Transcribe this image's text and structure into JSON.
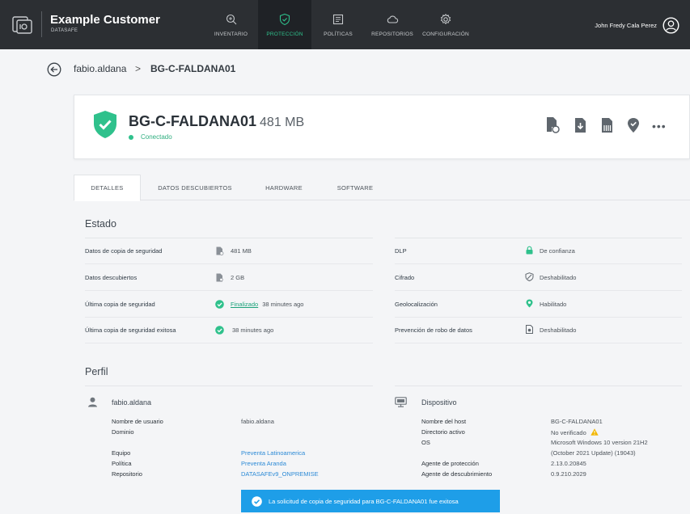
{
  "header": {
    "brand_name": "Example Customer",
    "brand_sub": "DATASAFE",
    "nav": [
      {
        "label": "INVENTARIO",
        "icon": "search-icon",
        "active": false
      },
      {
        "label": "PROTECCIÓN",
        "icon": "shield-icon",
        "active": true
      },
      {
        "label": "POLÍTICAS",
        "icon": "document-icon",
        "active": false
      },
      {
        "label": "REPOSITORIOS",
        "icon": "cloud-icon",
        "active": false
      },
      {
        "label": "CONFIGURACIÓN",
        "icon": "gear-icon",
        "active": false
      }
    ],
    "user_name": "John Fredy Cala Perez"
  },
  "breadcrumb": {
    "parent": "fabio.aldana",
    "separator": ">",
    "current": "BG-C-FALDANA01"
  },
  "device": {
    "name": "BG-C-FALDANA01",
    "size": "481 MB",
    "status": "Conectado",
    "more_label": "•••"
  },
  "tabs": [
    "DETALLES",
    "DATOS DESCUBIERTOS",
    "HARDWARE",
    "SOFTWARE"
  ],
  "estado": {
    "title": "Estado",
    "left": [
      {
        "label": "Datos de copia de seguridad",
        "icon": "backup-file-icon",
        "value": "481 MB",
        "link": ""
      },
      {
        "label": "Datos descubiertos",
        "icon": "discovered-file-icon",
        "value": "2 GB",
        "link": ""
      },
      {
        "label": "Última copia de seguridad",
        "icon": "check-circle-icon",
        "link": "Finalizado",
        "value": "38 minutes ago"
      },
      {
        "label": "Última copia de seguridad exitosa",
        "icon": "check-circle-icon",
        "value": "38 minutes ago",
        "link": ""
      }
    ],
    "right": [
      {
        "label": "DLP",
        "icon": "lock-icon",
        "value": "De confianza"
      },
      {
        "label": "Cifrado",
        "icon": "shield-off-icon",
        "value": "Deshabilitado"
      },
      {
        "label": "Geolocalización",
        "icon": "location-pin-icon",
        "value": "Habilitado"
      },
      {
        "label": "Prevención de robo de datos",
        "icon": "theft-prevention-icon",
        "value": "Deshabilitado"
      }
    ]
  },
  "perfil": {
    "title": "Perfil",
    "user": {
      "heading": "fabio.aldana",
      "fields": [
        {
          "label": "Nombre de usuario",
          "value": "fabio.aldana",
          "link": false
        },
        {
          "label": "Dominio",
          "value": "",
          "link": false
        },
        {
          "label": "Equipo",
          "value": "Preventa Latinoamerica",
          "link": true
        },
        {
          "label": "Política",
          "value": "Preventa Aranda",
          "link": true
        },
        {
          "label": "Repositorio",
          "value": "DATASAFEv9_ONPREMISE",
          "link": true
        }
      ]
    },
    "device": {
      "heading": "Dispositivo",
      "fields": [
        {
          "label": "Nombre del host",
          "value": "BG-C-FALDANA01"
        },
        {
          "label": "Directorio activo",
          "value": "No verificado"
        },
        {
          "label": "OS",
          "value": "Microsoft Windows 10 version 21H2",
          "value2": "(October 2021 Update) (19043)"
        },
        {
          "label": "Agente de protección",
          "value": "2.13.0.20845"
        },
        {
          "label": "Agente de descubrimiento",
          "value": "0.9.210.2029"
        }
      ]
    }
  },
  "toast": {
    "text": "La solicitud de copia de seguridad para BG-C-FALDANA01 fue exitosa"
  },
  "colors": {
    "topbar": "#2c2f33",
    "accent_green": "#2fc18c",
    "link_blue": "#2c8ad6",
    "toast_blue": "#1e9ee8",
    "warning_yellow": "#f2b705"
  }
}
